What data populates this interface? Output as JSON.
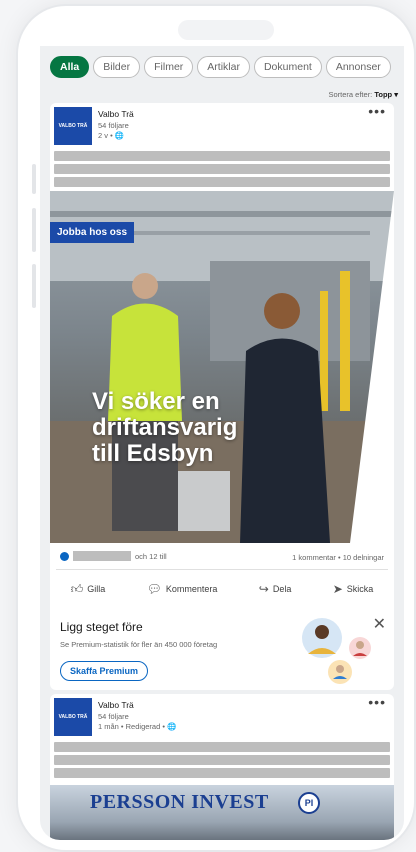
{
  "filters": [
    "Alla",
    "Bilder",
    "Filmer",
    "Artiklar",
    "Dokument",
    "Annonser"
  ],
  "sort": {
    "label": "Sortera efter:",
    "value": "Topp ▾"
  },
  "post1": {
    "logo_text": "VALBO TRÄ",
    "author": "Valbo Trä",
    "followers": "54 följare",
    "time": "2 v • 🌐",
    "tag": "Jobba hos oss",
    "headline_1": "Vi söker en",
    "headline_2": "driftansvarig",
    "headline_3": "till Edsbyn",
    "reaction_text": "och 12 till",
    "counts": "1 kommentar • 10 delningar",
    "actions": {
      "like": "Gilla",
      "comment": "Kommentera",
      "share": "Dela",
      "send": "Skicka"
    }
  },
  "promo": {
    "title": "Ligg steget före",
    "subtitle": "Se Premium-statistik för fler än 450 000 företag",
    "button": "Skaffa Premium"
  },
  "post2": {
    "logo_text": "VALBO TRÄ",
    "author": "Valbo Trä",
    "followers": "54 följare",
    "time": "1 mån • Redigerad • 🌐",
    "sign": "PERSSON INVEST",
    "sign_mark": "PI"
  },
  "colors": {
    "accent": "#057642",
    "brand": "#0a66c2",
    "company": "#1b4aa8"
  }
}
